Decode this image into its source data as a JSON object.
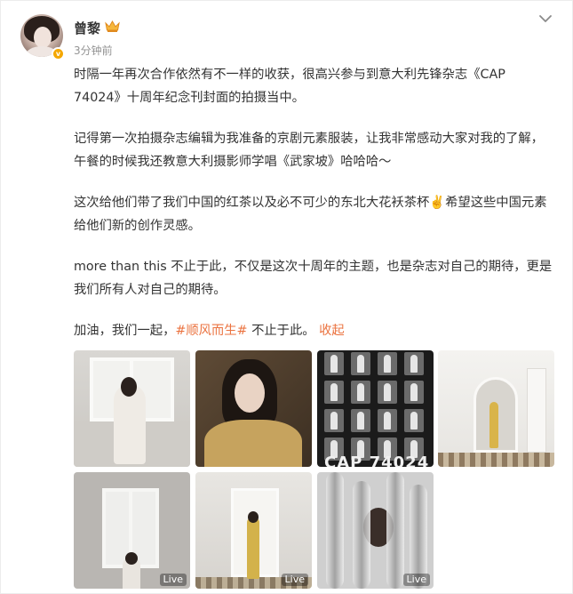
{
  "post": {
    "username": "曾黎",
    "time": "3分钟前",
    "verified_badge": "v",
    "paragraphs": [
      "时隔一年再次合作依然有不一样的收获，很高兴参与到意大利先锋杂志《CAP 74024》十周年纪念刊封面的拍摄当中。",
      "记得第一次拍摄杂志编辑为我准备的京剧元素服装，让我非常感动大家对我的了解，午餐的时候我还教意大利摄影师学唱《武家坡》哈哈哈～",
      "这次给他们带了我们中国的红茶以及必不可少的东北大花袄茶杯✌️希望这些中国元素给他们新的创作灵感。",
      "more than this 不止于此，不仅是这次十周年的主题，也是杂志对自己的期待，更是我们所有人对自己的期待。"
    ],
    "last_line": {
      "prefix": "加油，我们一起，",
      "hashtag": "#顺风而生#",
      "suffix": " 不止于此。 ",
      "collapse": "收起"
    }
  },
  "photos": {
    "contact_sheet_caption": "CAP 74024",
    "live_label": "Live"
  },
  "colors": {
    "link": "#eb7340",
    "badge": "#f4a700",
    "meta_text": "#939393"
  },
  "icons": [
    "crown-icon",
    "chevron-down-icon"
  ]
}
